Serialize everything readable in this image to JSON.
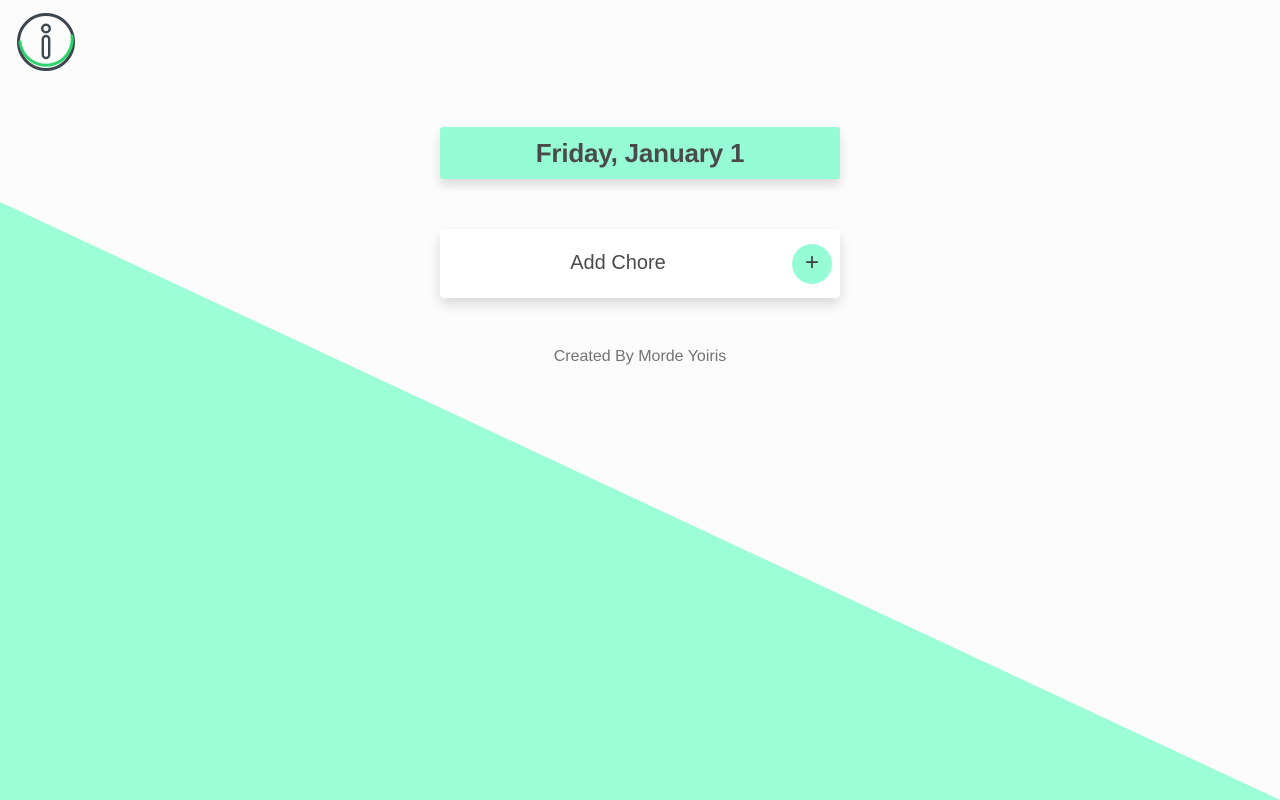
{
  "colors": {
    "accent": "#96fcd6",
    "background": "#fcfcfc",
    "triangle": "#9cfed6",
    "text_dark": "#4a4a4a",
    "text_muted": "#737373",
    "icon_ring": "#3c4650",
    "icon_arc": "#2bd46a"
  },
  "header": {
    "info_icon": "info-icon"
  },
  "date_banner": {
    "text": "Friday, January 1"
  },
  "add_chore": {
    "label": "Add Chore",
    "button_symbol": "+",
    "button_icon": "plus-icon"
  },
  "footer": {
    "credit": "Created By Morde Yoiris"
  }
}
